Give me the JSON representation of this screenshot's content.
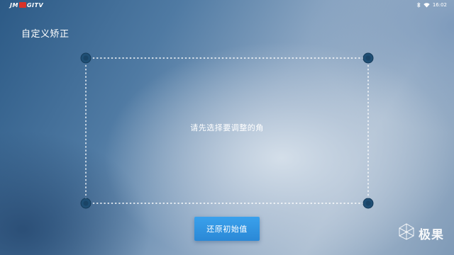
{
  "status_bar": {
    "brand_left": "JM",
    "brand_mid": "  ",
    "brand_right": "GITV",
    "icons": [
      "bluetooth-icon",
      "wifi-icon"
    ],
    "time": "16:02"
  },
  "page": {
    "title": "自定义矫正",
    "prompt": "请先选择要调整的角"
  },
  "corners": [
    "top-left",
    "top-right",
    "bottom-left",
    "bottom-right"
  ],
  "actions": {
    "reset_label": "还原初始值"
  },
  "watermark": {
    "text": "极果",
    "icon": "geometric-logo-icon"
  },
  "colors": {
    "accent": "#2f93e0",
    "corner_handle_fill": "#1f4f75",
    "frame_line": "#ffffff",
    "brand_red": "#d8332a"
  }
}
